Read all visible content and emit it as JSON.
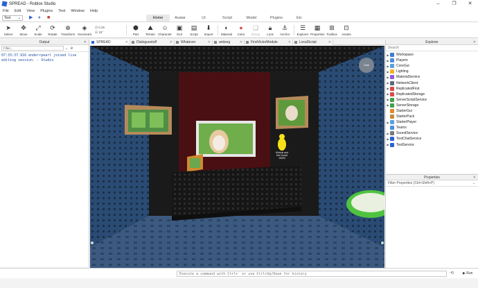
{
  "window": {
    "title": "SPREAD - Roblox Studio"
  },
  "window_controls": {
    "minimize": "–",
    "maximize": "❐",
    "close": "✕"
  },
  "menu": [
    "File",
    "Edit",
    "View",
    "Plugins",
    "Test",
    "Window",
    "Help"
  ],
  "mode_select": {
    "value": "Test"
  },
  "run_controls": {
    "play": "▶",
    "pause": "⏸",
    "stop": "■"
  },
  "ribbon_tabs": [
    {
      "label": "Home",
      "active": true
    },
    {
      "label": "Avatar"
    },
    {
      "label": "UI"
    },
    {
      "label": "Script"
    },
    {
      "label": "Model"
    },
    {
      "label": "Plugins"
    },
    {
      "label": "Etc"
    }
  ],
  "toolbar": {
    "tools": [
      "Select",
      "Move",
      "Scale",
      "Rotate",
      "Transform",
      "Geometric"
    ],
    "snap_move": "0.25",
    "snap_rotate": "15°",
    "insert": [
      "Part",
      "Terrain",
      "Character",
      "GUI",
      "Script",
      "Import"
    ],
    "edit": [
      "Material",
      "Color",
      "Group",
      "Lock",
      "Anchor"
    ],
    "panels": [
      "Explorer",
      "Properties",
      "Toolbox",
      "Assets"
    ]
  },
  "output": {
    "title": "Output",
    "filter_placeholder": "Filter...",
    "lines": [
      "07:33:37.916  enderrpearl joined live",
      "editing session.  -  Studio"
    ]
  },
  "doc_tabs": [
    {
      "label": "SPREAD",
      "active": true
    },
    {
      "label": "Dialoguestuff"
    },
    {
      "label": "Whatever"
    },
    {
      "label": "antizeg"
    },
    {
      "label": "FirstVictorModule"
    },
    {
      "label": "LocalScript"
    }
  ],
  "viewport": {
    "sign_text": [
      "Minicat and",
      "Mix Daniel",
      "15000"
    ],
    "camera_button": "Cam",
    "colors": {
      "wall": "#2a4b73",
      "floor": "#3c5a80",
      "curtain": "#4a0f12",
      "ceiling": "#0e0e0e"
    }
  },
  "explorer": {
    "title": "Explorer",
    "search_placeholder": "Search",
    "items": [
      {
        "label": "Workspace",
        "color": "#3a7bd5",
        "expand": "▶"
      },
      {
        "label": "Players",
        "color": "#4a90d9",
        "expand": "▶"
      },
      {
        "label": "CoreGui",
        "color": "#5aa0e0",
        "expand": "▶"
      },
      {
        "label": "Lighting",
        "color": "#f0b429",
        "expand": "▶"
      },
      {
        "label": "MaterialService",
        "color": "#8e5cd9",
        "expand": "▶"
      },
      {
        "label": "NetworkClient",
        "color": "#5a6b7c",
        "expand": "▶"
      },
      {
        "label": "ReplicatedFirst",
        "color": "#d94a4a",
        "expand": "▶"
      },
      {
        "label": "ReplicatedStorage",
        "color": "#d94a4a",
        "expand": "▶"
      },
      {
        "label": "ServerScriptService",
        "color": "#3fa34d",
        "expand": "▶"
      },
      {
        "label": "ServerStorage",
        "color": "#3fa34d",
        "expand": "▶"
      },
      {
        "label": "StarterGui",
        "color": "#e08a2c",
        "expand": ""
      },
      {
        "label": "StarterPack",
        "color": "#c58a3a",
        "expand": ""
      },
      {
        "label": "StarterPlayer",
        "color": "#5aa0e0",
        "expand": "▶"
      },
      {
        "label": "Teams",
        "color": "#4a90d9",
        "expand": ""
      },
      {
        "label": "SoundService",
        "color": "#7a7a7a",
        "expand": "▶"
      },
      {
        "label": "TextChatService",
        "color": "#2b62d6",
        "expand": "▶"
      },
      {
        "label": "TestService",
        "color": "#2b62d6",
        "expand": "▶"
      }
    ]
  },
  "properties": {
    "title": "Properties",
    "filter_placeholder": "Filter Properties (Ctrl+Shift+P)"
  },
  "command_bar": {
    "placeholder": "Execute a command with Ctrl+` or use Ctrl+Up/Down for history",
    "run_label": "▶ Run",
    "history_icon": "⟲"
  }
}
